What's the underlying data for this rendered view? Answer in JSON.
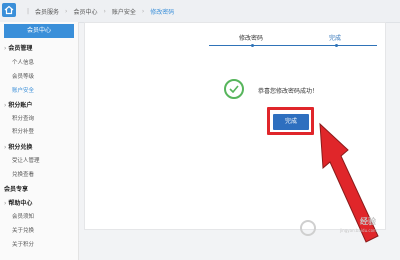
{
  "header": {
    "breadcrumbs": [
      "会员服务",
      "会员中心",
      "账户安全"
    ],
    "current": "修改密码"
  },
  "sidebar": {
    "title": "会员中心",
    "groups": [
      {
        "label": "会员管理",
        "items": [
          "个人信息",
          "会员等级",
          "账户安全"
        ]
      },
      {
        "label": "积分账户",
        "items": [
          "积分查询",
          "积分补登"
        ]
      },
      {
        "label": "积分兑换",
        "items": [
          "受让人管理",
          "兑换查看"
        ]
      },
      {
        "label": "会员专享",
        "items": []
      },
      {
        "label": "帮助中心",
        "items": [
          "会员须知",
          "关于兑换",
          "关于积分"
        ]
      }
    ],
    "active_item": "账户安全"
  },
  "steps": [
    {
      "label": "修改密码"
    },
    {
      "label": "完成",
      "current": true
    }
  ],
  "result": {
    "message": "恭喜您修改密码成功！",
    "confirm_label": "完成"
  },
  "watermark": {
    "title": "经验",
    "subtitle": "jingyan.baidu.com"
  },
  "colors": {
    "accent": "#3a8fd9",
    "button": "#2e6fbf",
    "success": "#57b55c",
    "annotation": "#e0262a"
  }
}
